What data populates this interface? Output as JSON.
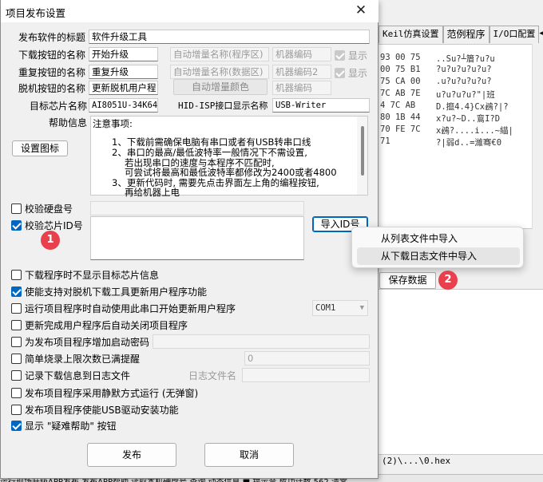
{
  "bg": {
    "tabs": [
      "Keil仿真设置",
      "范例程序",
      "I/O口配置"
    ],
    "tab_arrow_icon": "tab-scroll-arrows",
    "hex_rows": [
      {
        "hex": "93 00 75",
        "ascii": "..Su?┴篃?u?u"
      },
      {
        "hex": "00 75 B1",
        "ascii": "?u?u?u?u?u?"
      },
      {
        "hex": "75 CA 00",
        "ascii": ".u?u?u?u?u?"
      },
      {
        "hex": "7C AB 7E",
        "ascii": "u?u?u?u?\"|班"
      },
      {
        "hex": "4 7C AB",
        "ascii": "D.攛4.4}Cx鴓?|?"
      },
      {
        "hex": "80 1B 44",
        "ascii": "x?u?~D..鵉I?D"
      },
      {
        "hex": "70 FE 7C",
        "ascii": "x鴓?....i...~緢|"
      },
      {
        "hex": "71",
        "ascii": "?|弱d..=濰骞€0"
      }
    ],
    "save_button": "保存数据",
    "path": "(2)\\...\\0.hex",
    "status": "运行现场升级APP发布   发布APP帮助   读取本机硬盘号   查询   动态信息   ■ 提示音   成功计数   562   清零"
  },
  "dialog": {
    "title": "项目发布设置",
    "close_icon": "close-icon",
    "labels": {
      "soft_title": "发布软件的标题",
      "download_btn_name": "下载按钮的名称",
      "repeat_btn_name": "重复按钮的名称",
      "offline_btn_name": "脱机按钮的名称",
      "target_chip": "目标芯片名称",
      "hid_name": "HID-ISP接口显示名称",
      "help_info": "帮助信息"
    },
    "values": {
      "soft_title": "软件升级工具",
      "download_btn_name": "开始升级",
      "repeat_btn_name": "重复升级",
      "offline_btn_name": "更新脱机用户程",
      "target_chip": "AI8051U-34K64",
      "hid_name": "USB-Writer"
    },
    "auto_inc": {
      "program_label": "自动增量名称(程序区)",
      "program_code": "机器编码",
      "data_label": "自动增量名称(数据区)",
      "data_code": "机器编码2",
      "color_button": "自动增量颜色",
      "color_code": "机器编码",
      "show_label": "显示"
    },
    "set_icon_button": "设置图标",
    "help_lines": [
      "注意事项:",
      "1、下载前需确保电脑有串口或者有USB转串口线",
      "2、串口的最高/最低波特率一般情况下不需设置,",
      "若出现串口的速度与本程序不匹配时,",
      "可尝试将最高和最低波特率都修改为2400或者4800",
      "3、更新代码时, 需要先点击界面左上角的编程按钮,",
      "再给机器上电"
    ],
    "verify_disk": "校验硬盘号",
    "verify_chip": "校验芯片ID号",
    "import_button": "导入ID号",
    "import_menu": [
      "从列表文件中导入",
      "从下载日志文件中导入"
    ],
    "badge1": "1",
    "badge2": "2",
    "options": [
      {
        "label": "下载程序时不显示目标芯片信息",
        "checked": false
      },
      {
        "label": "使能支持对脱机下载工具更新用户程序功能",
        "checked": true
      },
      {
        "label": "运行项目程序时自动使用此串口开始更新用户程序",
        "checked": false
      },
      {
        "label": "更新完成用户程序后自动关闭项目程序",
        "checked": false
      },
      {
        "label": "为发布项目程序增加启动密码",
        "checked": false
      },
      {
        "label": "简单烧录上限次数已满提醒",
        "checked": false
      },
      {
        "label": "记录下载信息到日志文件",
        "checked": false
      },
      {
        "label": "发布项目程序采用静默方式运行 (无弹窗)",
        "checked": false
      },
      {
        "label": "发布项目程序使能USB驱动安装功能",
        "checked": false
      },
      {
        "label": "显示 \"疑难帮助\" 按钮",
        "checked": true
      }
    ],
    "com_port": "COM1",
    "limit_value": "0",
    "log_file_label": "日志文件名",
    "publish_button": "发布",
    "cancel_button": "取消"
  }
}
